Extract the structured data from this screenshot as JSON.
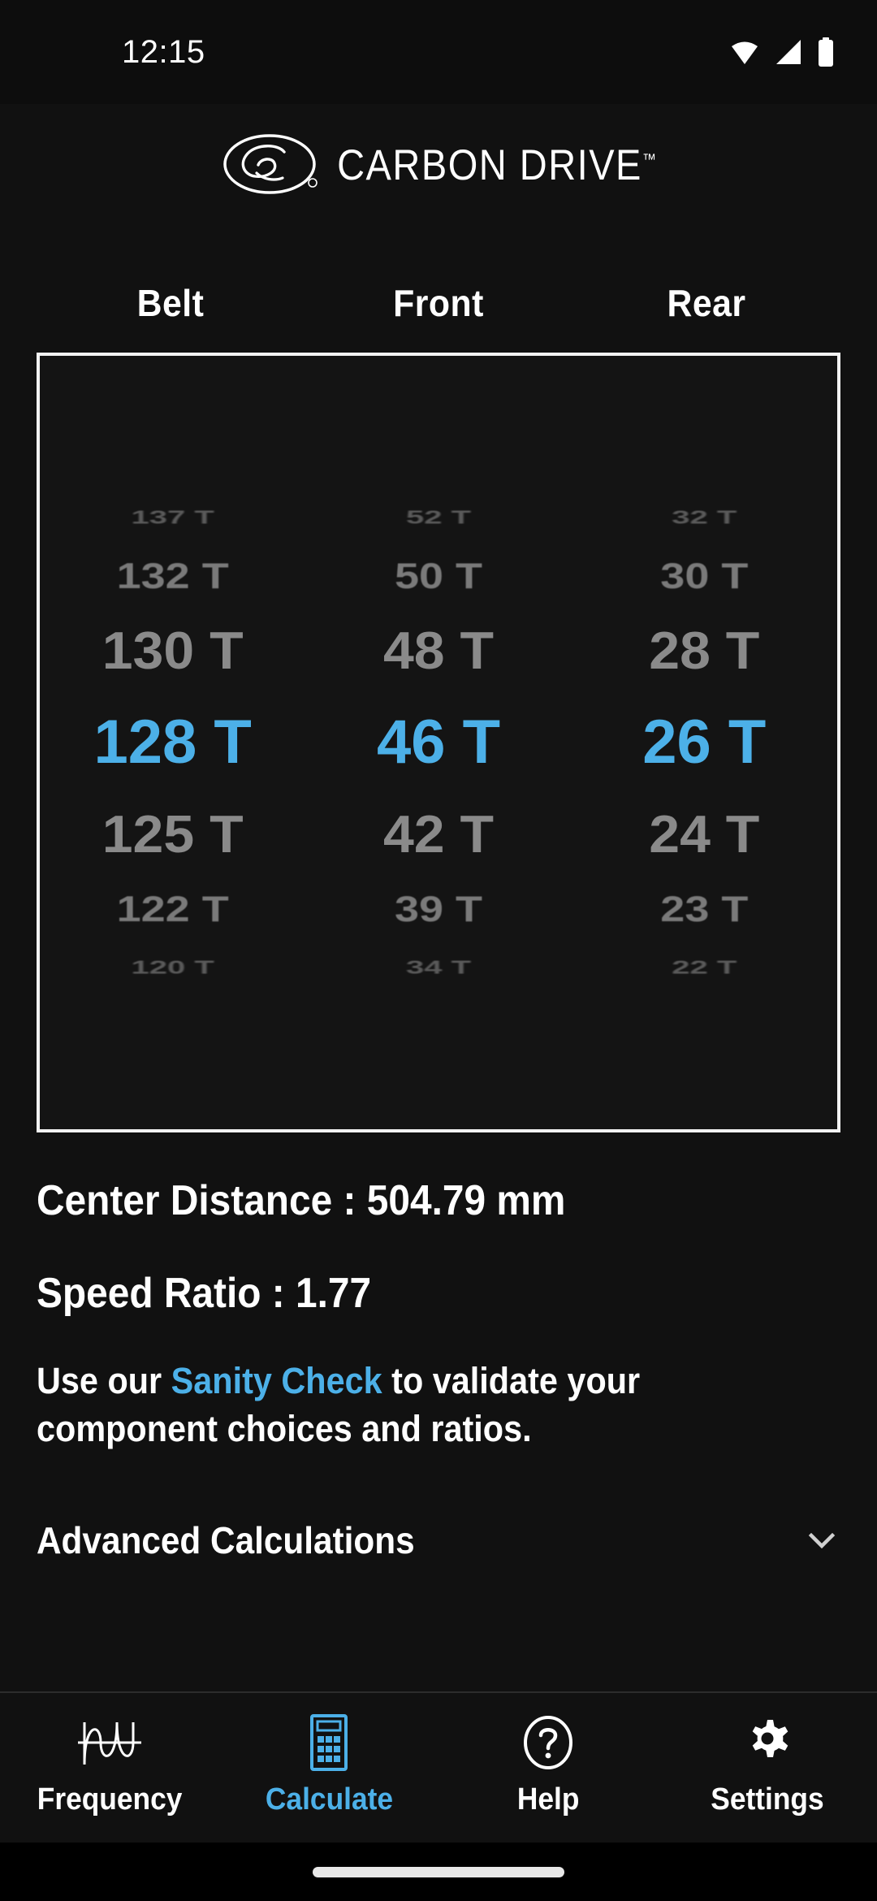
{
  "status_bar": {
    "clock": "12:15",
    "icons": [
      "wifi-icon",
      "cellular-signal-icon",
      "battery-icon"
    ]
  },
  "brand": {
    "mark": "gates-oval-logo",
    "name": "CARBON DRIVE",
    "trademark": "™"
  },
  "picker": {
    "headers": [
      "Belt",
      "Front",
      "Rear"
    ],
    "unit": "T",
    "columns": [
      {
        "name": "belt",
        "header": "Belt",
        "selected": "128 T",
        "items": [
          "137 T",
          "132 T",
          "130 T",
          "128 T",
          "125 T",
          "122 T",
          "120 T"
        ],
        "selected_index": 3
      },
      {
        "name": "front",
        "header": "Front",
        "selected": "46 T",
        "items": [
          "52 T",
          "50 T",
          "48 T",
          "46 T",
          "42 T",
          "39 T",
          "34 T"
        ],
        "selected_index": 3
      },
      {
        "name": "rear",
        "header": "Rear",
        "selected": "26 T",
        "items": [
          "32 T",
          "30 T",
          "28 T",
          "26 T",
          "24 T",
          "23 T",
          "22 T"
        ],
        "selected_index": 3
      }
    ]
  },
  "results": {
    "center_distance": "Center Distance : 504.79 mm",
    "speed_ratio": "Speed Ratio : 1.77",
    "sanity_prefix": "Use our ",
    "sanity_link": "Sanity Check",
    "sanity_suffix": " to validate your component choices and ratios."
  },
  "advanced": {
    "label": "Advanced Calculations",
    "chevron": "chevron-down-icon"
  },
  "nav": {
    "items": [
      {
        "label": "Frequency",
        "icon": "waveform-icon",
        "active": false
      },
      {
        "label": "Calculate",
        "icon": "calculator-icon",
        "active": true
      },
      {
        "label": "Help",
        "icon": "question-circle-icon",
        "active": false
      },
      {
        "label": "Settings",
        "icon": "gear-icon",
        "active": false
      }
    ]
  },
  "colors": {
    "accent": "#4cb0e8",
    "background": "#111111",
    "status_bar_bg": "#0d0d0d",
    "picker_border": "#f2f2f2",
    "inactive_item": "#8a8a8a",
    "text": "#ffffff"
  }
}
